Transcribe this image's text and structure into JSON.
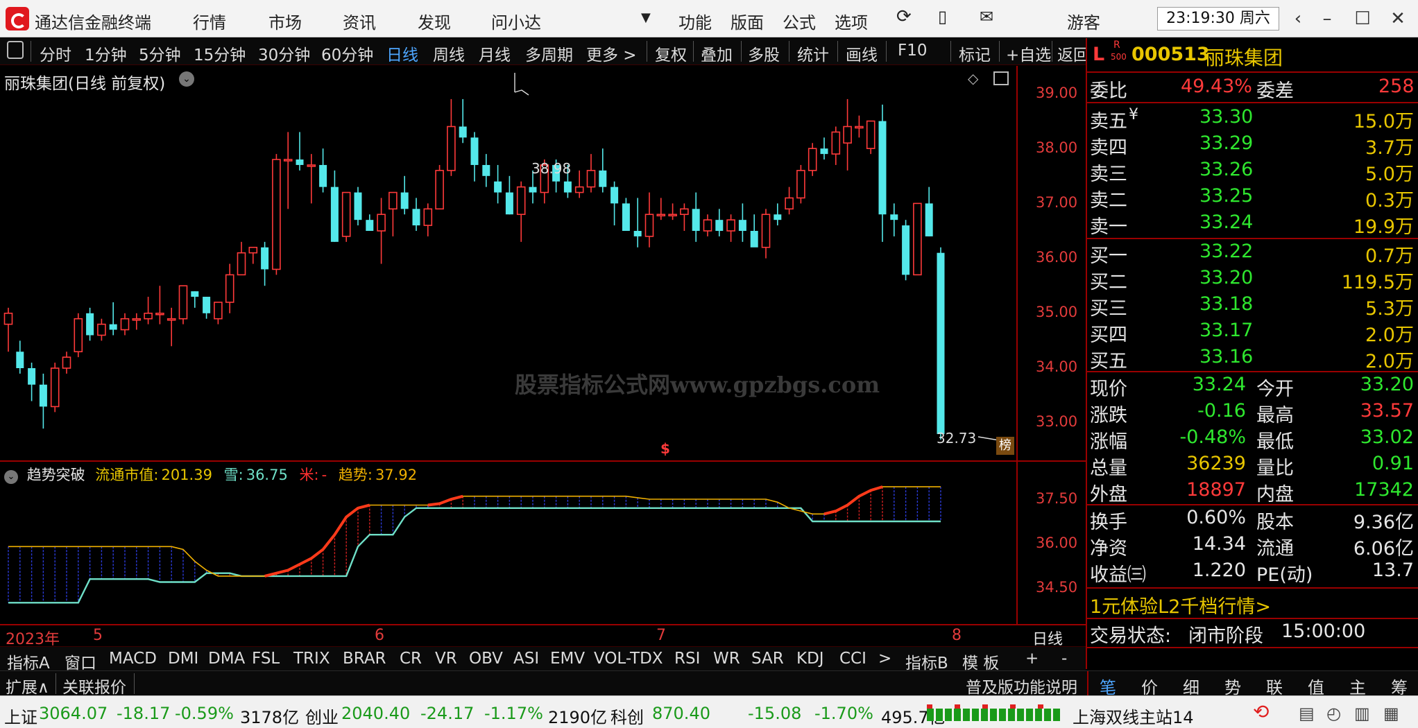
{
  "app": {
    "title": "通达信金融终端",
    "menu": [
      "行情",
      "市场",
      "资讯",
      "发现",
      "问小达"
    ],
    "menu_right": [
      "功能",
      "版面",
      "公式",
      "选项"
    ],
    "user": "游客",
    "clock": "23:19:30 周六"
  },
  "toolbar": {
    "periods": [
      "分时",
      "1分钟",
      "5分钟",
      "15分钟",
      "30分钟",
      "60分钟",
      "日线",
      "周线",
      "月线",
      "多周期",
      "更多 >"
    ],
    "active_period": "日线",
    "tools": [
      "复权",
      "叠加",
      "多股",
      "统计",
      "画线",
      "F10",
      "标记",
      "+自选",
      "返回"
    ]
  },
  "chart": {
    "title": "丽珠集团(日线 前复权)",
    "y_labels": [
      "39.00",
      "38.00",
      "37.00",
      "36.00",
      "35.00",
      "34.00",
      "33.00"
    ],
    "high_marker": "38.98",
    "low_marker": "32.73",
    "rank_badge": "榜",
    "dollar_marker": "$",
    "watermark": "股票指标公式网www.gpzbgs.com"
  },
  "indicator": {
    "name": "趋势突破",
    "items": [
      {
        "label": "流通市值:",
        "value": "201.39",
        "color": "#e8c600"
      },
      {
        "label": "雪:",
        "value": "36.75",
        "color": "#6fe0c8"
      },
      {
        "label": "米:",
        "value": "-",
        "color": "#ff3030"
      },
      {
        "label": "趋势:",
        "value": "37.92",
        "color": "#f0b000"
      }
    ],
    "y_labels": [
      "37.50",
      "36.00",
      "34.50"
    ]
  },
  "time_axis": {
    "labels": [
      "2023年",
      "5",
      "6",
      "7",
      "8"
    ],
    "period_label": "日线"
  },
  "chart_data": {
    "type": "candlestick",
    "title": "丽珠集团(日线 前复权)",
    "ylim": [
      32.5,
      39.3
    ],
    "candles": [
      [
        34.8,
        35.1,
        34.3,
        35.0
      ],
      [
        34.3,
        34.5,
        33.9,
        34.0
      ],
      [
        34.0,
        34.1,
        33.4,
        33.7
      ],
      [
        33.7,
        33.9,
        32.9,
        33.3
      ],
      [
        33.3,
        34.1,
        33.2,
        34.0
      ],
      [
        34.0,
        34.3,
        33.9,
        34.2
      ],
      [
        34.3,
        35.0,
        34.2,
        34.9
      ],
      [
        35.0,
        35.1,
        34.5,
        34.6
      ],
      [
        34.6,
        34.9,
        34.5,
        34.8
      ],
      [
        34.8,
        35.2,
        34.6,
        34.7
      ],
      [
        34.7,
        35.0,
        34.6,
        34.9
      ],
      [
        34.9,
        35.0,
        34.7,
        34.9
      ],
      [
        34.9,
        35.3,
        34.8,
        35.0
      ],
      [
        35.0,
        35.5,
        34.8,
        35.0
      ],
      [
        34.9,
        35.1,
        34.4,
        34.9
      ],
      [
        34.9,
        35.5,
        34.8,
        35.5
      ],
      [
        35.4,
        35.4,
        35.1,
        35.3
      ],
      [
        35.3,
        35.3,
        34.9,
        35.0
      ],
      [
        34.9,
        35.2,
        34.8,
        35.2
      ],
      [
        35.2,
        35.9,
        35.0,
        35.7
      ],
      [
        35.7,
        36.3,
        35.7,
        36.1
      ],
      [
        36.1,
        36.2,
        35.9,
        36.2
      ],
      [
        36.2,
        36.3,
        35.5,
        35.8
      ],
      [
        35.8,
        37.9,
        35.7,
        37.8
      ],
      [
        37.8,
        38.3,
        36.9,
        37.8
      ],
      [
        37.8,
        38.3,
        37.6,
        37.7
      ],
      [
        37.7,
        37.9,
        37.0,
        37.7
      ],
      [
        37.7,
        38.0,
        37.2,
        37.3
      ],
      [
        37.3,
        37.6,
        36.3,
        36.3
      ],
      [
        36.4,
        37.1,
        36.3,
        37.2
      ],
      [
        37.2,
        37.3,
        36.6,
        36.7
      ],
      [
        36.7,
        36.8,
        36.5,
        36.5
      ],
      [
        36.5,
        37.1,
        35.9,
        36.8
      ],
      [
        36.9,
        37.2,
        36.4,
        37.2
      ],
      [
        37.2,
        37.5,
        36.8,
        36.9
      ],
      [
        36.9,
        37.1,
        36.5,
        36.6
      ],
      [
        36.6,
        37.0,
        36.4,
        36.9
      ],
      [
        36.9,
        37.7,
        36.9,
        37.6
      ],
      [
        37.6,
        38.9,
        37.5,
        38.4
      ],
      [
        38.4,
        38.9,
        38.1,
        38.2
      ],
      [
        38.2,
        38.3,
        37.4,
        37.7
      ],
      [
        37.7,
        37.9,
        37.3,
        37.5
      ],
      [
        37.4,
        37.7,
        37.0,
        37.2
      ],
      [
        37.2,
        37.5,
        36.8,
        36.8
      ],
      [
        36.8,
        37.4,
        36.3,
        37.3
      ],
      [
        37.3,
        37.6,
        37.0,
        37.2
      ],
      [
        37.2,
        37.8,
        37.0,
        37.7
      ],
      [
        37.7,
        37.8,
        37.2,
        37.4
      ],
      [
        37.4,
        37.7,
        37.1,
        37.2
      ],
      [
        37.2,
        37.6,
        37.1,
        37.3
      ],
      [
        37.3,
        37.9,
        37.2,
        37.6
      ],
      [
        37.6,
        38.0,
        37.2,
        37.3
      ],
      [
        37.3,
        37.4,
        36.6,
        37.0
      ],
      [
        37.0,
        37.1,
        36.5,
        36.5
      ],
      [
        36.5,
        37.1,
        36.2,
        36.4
      ],
      [
        36.4,
        37.2,
        36.2,
        36.8
      ],
      [
        36.8,
        37.1,
        36.7,
        36.8
      ],
      [
        36.8,
        37.0,
        36.7,
        36.8
      ],
      [
        36.8,
        37.0,
        36.5,
        36.9
      ],
      [
        36.9,
        37.2,
        36.3,
        36.5
      ],
      [
        36.5,
        36.8,
        36.4,
        36.7
      ],
      [
        36.7,
        36.9,
        36.4,
        36.5
      ],
      [
        36.5,
        36.8,
        36.3,
        36.7
      ],
      [
        36.7,
        37.0,
        36.3,
        36.5
      ],
      [
        36.5,
        36.8,
        36.4,
        36.2
      ],
      [
        36.2,
        36.9,
        36.0,
        36.8
      ],
      [
        36.8,
        37.0,
        36.6,
        36.7
      ],
      [
        36.9,
        37.3,
        36.8,
        37.1
      ],
      [
        37.1,
        37.7,
        37.0,
        37.6
      ],
      [
        37.6,
        38.1,
        37.5,
        38.0
      ],
      [
        38.0,
        38.2,
        37.8,
        37.9
      ],
      [
        37.9,
        38.4,
        37.7,
        38.3
      ],
      [
        38.1,
        38.9,
        37.6,
        38.4
      ],
      [
        38.4,
        38.6,
        38.2,
        38.4
      ],
      [
        38.0,
        38.5,
        37.9,
        38.5
      ],
      [
        38.5,
        38.8,
        36.3,
        36.8
      ],
      [
        36.8,
        37.0,
        36.4,
        36.7
      ],
      [
        36.6,
        36.7,
        35.6,
        35.7
      ],
      [
        35.7,
        37.0,
        35.7,
        37.0
      ],
      [
        37.0,
        37.3,
        36.4,
        36.4
      ],
      [
        36.1,
        36.2,
        32.7,
        32.8
      ]
    ],
    "trend_line": [
      35.9,
      35.9,
      35.9,
      35.9,
      35.9,
      35.9,
      35.9,
      35.9,
      35.9,
      35.9,
      35.9,
      35.9,
      35.9,
      35.9,
      35.9,
      35.8,
      35.4,
      35.1,
      34.9,
      34.9,
      34.9,
      34.9,
      34.9,
      35.0,
      35.1,
      35.3,
      35.5,
      35.8,
      36.3,
      36.9,
      37.2,
      37.3,
      37.3,
      37.3,
      37.3,
      37.3,
      37.3,
      37.35,
      37.5,
      37.6,
      37.6,
      37.6,
      37.6,
      37.6,
      37.6,
      37.6,
      37.6,
      37.6,
      37.6,
      37.6,
      37.6,
      37.6,
      37.6,
      37.6,
      37.55,
      37.5,
      37.5,
      37.5,
      37.5,
      37.5,
      37.5,
      37.5,
      37.5,
      37.5,
      37.5,
      37.5,
      37.4,
      37.2,
      37.1,
      37.0,
      37.0,
      37.1,
      37.3,
      37.6,
      37.8,
      37.92,
      37.92,
      37.92,
      37.92,
      37.92,
      37.92
    ],
    "xue_line": [
      34.0,
      34.0,
      34.0,
      34.0,
      34.0,
      34.0,
      34.0,
      34.8,
      34.8,
      34.8,
      34.8,
      34.8,
      34.8,
      34.7,
      34.7,
      34.7,
      34.7,
      35.0,
      35.0,
      35.0,
      34.9,
      34.9,
      34.9,
      34.9,
      34.9,
      34.9,
      34.9,
      34.9,
      34.9,
      34.9,
      35.9,
      36.3,
      36.3,
      36.3,
      36.9,
      37.2,
      37.2,
      37.2,
      37.2,
      37.2,
      37.2,
      37.2,
      37.2,
      37.2,
      37.2,
      37.2,
      37.2,
      37.2,
      37.2,
      37.2,
      37.2,
      37.2,
      37.2,
      37.2,
      37.2,
      37.2,
      37.2,
      37.2,
      37.2,
      37.2,
      37.2,
      37.2,
      37.2,
      37.2,
      37.2,
      37.2,
      37.2,
      37.2,
      37.2,
      36.75,
      36.75,
      36.75,
      36.75,
      36.75,
      36.75,
      36.75,
      36.75,
      36.75,
      36.75,
      36.75,
      36.75
    ]
  },
  "quote": {
    "market_badge": "L",
    "r_badge": "R",
    "r_badge_sub": "500",
    "code": "000513",
    "name": "丽珠集团",
    "weibi_label": "委比",
    "weibi": "49.43%",
    "weicha_label": "委差",
    "weicha": "258",
    "sells": [
      {
        "label": "卖五",
        "flag": "¥",
        "price": "33.30",
        "vol": "15.0万"
      },
      {
        "label": "卖四",
        "flag": "",
        "price": "33.29",
        "vol": "3.7万"
      },
      {
        "label": "卖三",
        "flag": "",
        "price": "33.26",
        "vol": "5.0万"
      },
      {
        "label": "卖二",
        "flag": "",
        "price": "33.25",
        "vol": "0.3万"
      },
      {
        "label": "卖一",
        "flag": "",
        "price": "33.24",
        "vol": "19.9万"
      }
    ],
    "buys": [
      {
        "label": "买一",
        "price": "33.22",
        "vol": "0.7万"
      },
      {
        "label": "买二",
        "price": "33.20",
        "vol": "119.5万"
      },
      {
        "label": "买三",
        "price": "33.18",
        "vol": "5.3万"
      },
      {
        "label": "买四",
        "price": "33.17",
        "vol": "2.0万"
      },
      {
        "label": "买五",
        "price": "33.16",
        "vol": "2.0万"
      }
    ],
    "stats": [
      {
        "l1": "现价",
        "v1": "33.24",
        "c1": "#2fe82f",
        "l2": "今开",
        "v2": "33.20",
        "c2": "#2fe82f"
      },
      {
        "l1": "涨跌",
        "v1": "-0.16",
        "c1": "#2fe82f",
        "l2": "最高",
        "v2": "33.57",
        "c2": "#ff3a3a"
      },
      {
        "l1": "涨幅",
        "v1": "-0.48%",
        "c1": "#2fe82f",
        "l2": "最低",
        "v2": "33.02",
        "c2": "#2fe82f"
      },
      {
        "l1": "总量",
        "v1": "36239",
        "c1": "#e8c600",
        "l2": "量比",
        "v2": "0.91",
        "c2": "#2fe82f"
      },
      {
        "l1": "外盘",
        "v1": "18897",
        "c1": "#ff3a3a",
        "l2": "内盘",
        "v2": "17342",
        "c2": "#2fe82f"
      }
    ],
    "stats2": [
      {
        "l1": "换手",
        "v1": "0.60%",
        "l2": "股本",
        "v2": "9.36亿"
      },
      {
        "l1": "净资",
        "v1": "14.34",
        "l2": "流通",
        "v2": "6.06亿"
      },
      {
        "l1": "收益㈢",
        "v1": "1.220",
        "l2": "PE(动)",
        "v2": "13.7"
      }
    ],
    "promo": "1元体验L2千档行情>",
    "trade_state_label": "交易状态:",
    "trade_state": "闭市阶段",
    "trade_time": "15:00:00"
  },
  "indicator_tabs": [
    "指标A",
    "窗口",
    "MACD",
    "DMI",
    "DMA",
    "FSL",
    "TRIX",
    "BRAR",
    "CR",
    "VR",
    "OBV",
    "ASI",
    "EMV",
    "VOL-TDX",
    "RSI",
    "WR",
    "SAR",
    "KDJ",
    "CCI",
    ">",
    "指标B",
    "模 板",
    "+",
    "-"
  ],
  "ext_bar": {
    "left": [
      "扩展∧",
      "关联报价"
    ],
    "right": "普及版功能说明",
    "panel_tabs": [
      "笔",
      "价",
      "细",
      "势",
      "联",
      "值",
      "主",
      "筹"
    ],
    "active_tab": "笔"
  },
  "status": {
    "indices": [
      {
        "name": "上证",
        "value": "3064.07",
        "chg": "-18.17",
        "pct": "-0.59%",
        "amt": "3178亿"
      },
      {
        "name": "创业",
        "value": "2040.40",
        "chg": "-24.17",
        "pct": "-1.17%",
        "amt": "2190亿"
      },
      {
        "name": "科创",
        "value": "870.40",
        "chg": "-15.08",
        "pct": "-1.70%",
        "amt": "495.7亿"
      }
    ],
    "server": "上海双线主站14"
  },
  "colors": {
    "up": "#ff3a3a",
    "down": "#54e8ea",
    "accent_red": "#9a0000"
  }
}
